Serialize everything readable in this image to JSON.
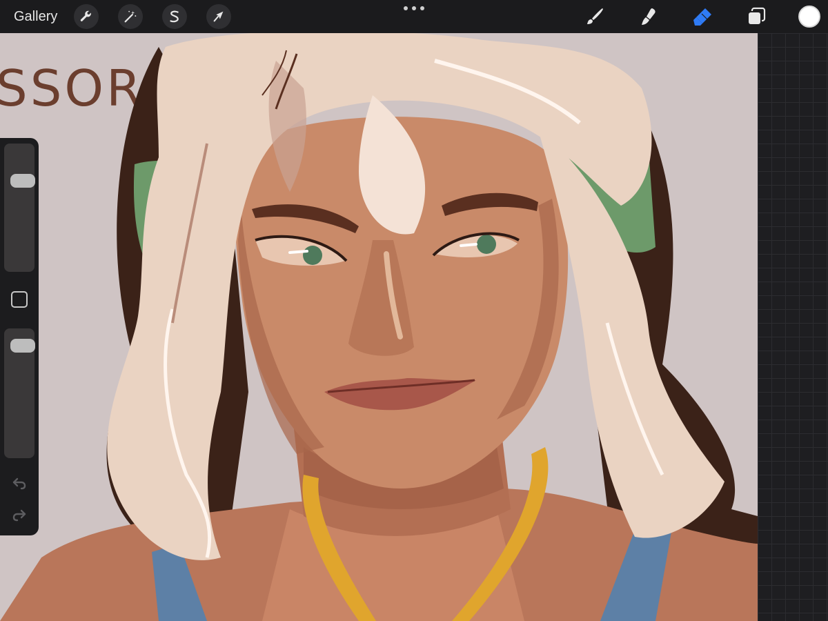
{
  "topbar": {
    "gallery_label": "Gallery",
    "tools_left": [
      "wrench-icon",
      "magic-wand-icon",
      "selection-s-icon",
      "transform-arrow-icon"
    ],
    "tools_right": [
      "brush-icon",
      "smudge-icon",
      "eraser-icon",
      "layers-icon"
    ],
    "active_tool": "eraser",
    "current_color": "#ffffff",
    "accent": "#2f7bf5"
  },
  "canvas": {
    "visible_text": "SSOR",
    "background": "#cfc4c4"
  },
  "sidebar": {
    "brush_size_level": 0.25,
    "opacity_level": 0.07
  }
}
